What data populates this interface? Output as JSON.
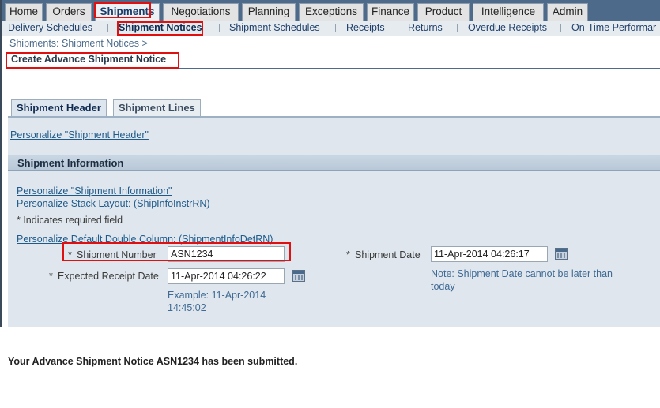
{
  "top_tabs": [
    "Home",
    "Orders",
    "Shipments",
    "Negotiations",
    "Planning",
    "Exceptions",
    "Finance",
    "Product",
    "Intelligence",
    "Admin"
  ],
  "active_top_tab": "Shipments",
  "sub_nav": [
    "Delivery Schedules",
    "Shipment Notices",
    "Shipment Schedules",
    "Receipts",
    "Returns",
    "Overdue Receipts",
    "On-Time Performar"
  ],
  "active_sub_nav": "Shipment Notices",
  "breadcrumb": "Shipments: Shipment Notices  >",
  "page_title": "Create Advance Shipment Notice",
  "content_tabs": [
    "Shipment Header",
    "Shipment Lines"
  ],
  "personalize_header": "Personalize \"Shipment Header\"",
  "section_title": "Shipment Information",
  "personalize_info": "Personalize \"Shipment Information\"",
  "personalize_stack": "Personalize Stack Layout: (ShipInfoInstrRN)",
  "required_note": "* Indicates required field",
  "personalize_double": "Personalize Default Double Column: (ShipmentInfoDetRN)",
  "fields": {
    "shipment_number_label": "Shipment Number",
    "shipment_number_value": "ASN1234",
    "expected_receipt_label": "Expected Receipt Date",
    "expected_receipt_value": "11-Apr-2014 04:26:22",
    "expected_receipt_example_1": "Example: 11-Apr-2014",
    "expected_receipt_example_2": "14:45:02",
    "shipment_date_label": "Shipment Date",
    "shipment_date_value": "11-Apr-2014 04:26:17",
    "shipment_date_note_1": "Note: Shipment Date cannot be later than",
    "shipment_date_note_2": "today"
  },
  "required_mark": "*",
  "submitted_message": "Your Advance Shipment Notice ASN1234 has been submitted.",
  "colors": {
    "highlight": "#e01010",
    "header_bar": "#4d6a8a",
    "panel": "#dfe6ee",
    "link": "#1f5b8a"
  }
}
